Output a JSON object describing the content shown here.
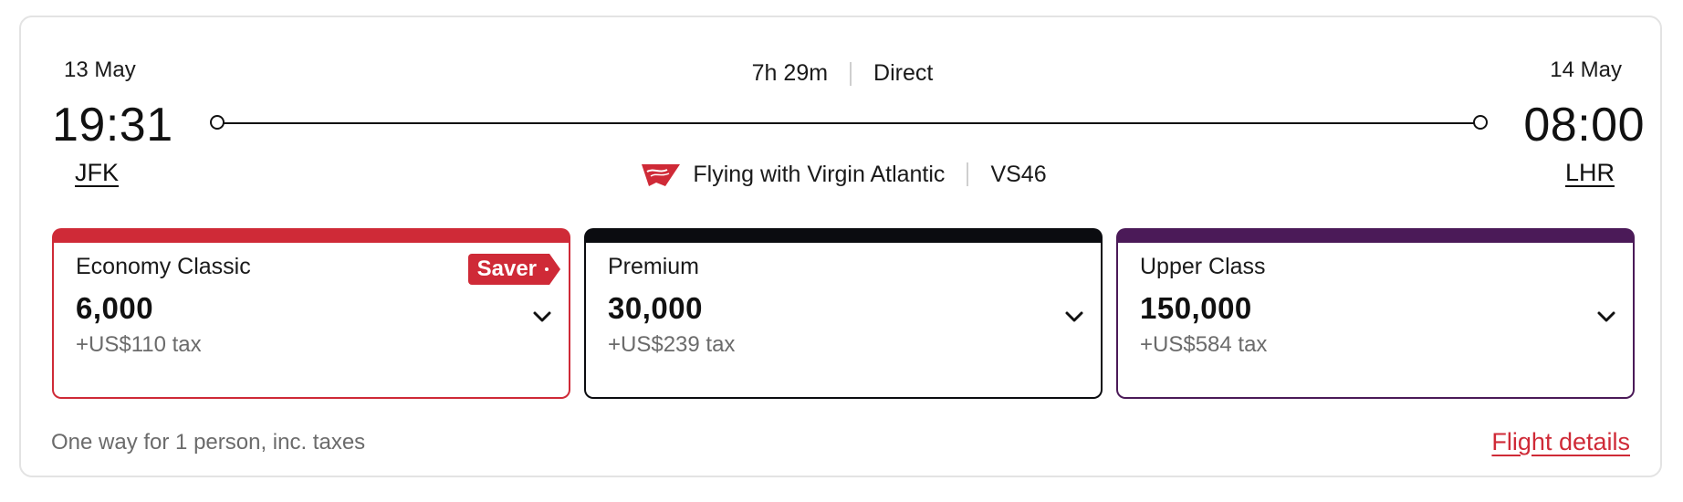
{
  "flight": {
    "departure": {
      "date": "13 May",
      "time": "19:31",
      "airport": "JFK"
    },
    "arrival": {
      "date": "14 May",
      "time": "08:00",
      "airport": "LHR"
    },
    "duration": "7h 29m",
    "stops": "Direct",
    "operated_by": "Flying with Virgin Atlantic",
    "flight_number": "VS46",
    "airline_logo_icon": "virgin-atlantic-logo"
  },
  "fares": [
    {
      "cabin": "Economy Classic",
      "points": "6,000",
      "tax": "+US$110 tax",
      "badge": "Saver",
      "accent": "#cf2a37",
      "icon": "chevron-down-icon"
    },
    {
      "cabin": "Premium",
      "points": "30,000",
      "tax": "+US$239 tax",
      "accent": "#0b0c10",
      "icon": "chevron-down-icon"
    },
    {
      "cabin": "Upper Class",
      "points": "150,000",
      "tax": "+US$584 tax",
      "accent": "#4b1a58",
      "icon": "chevron-down-icon"
    }
  ],
  "footer": {
    "note": "One way for 1 person, inc. taxes",
    "details_link": "Flight details"
  },
  "colors": {
    "brand_red": "#cf2a37",
    "text_muted": "#6b6b6b"
  }
}
